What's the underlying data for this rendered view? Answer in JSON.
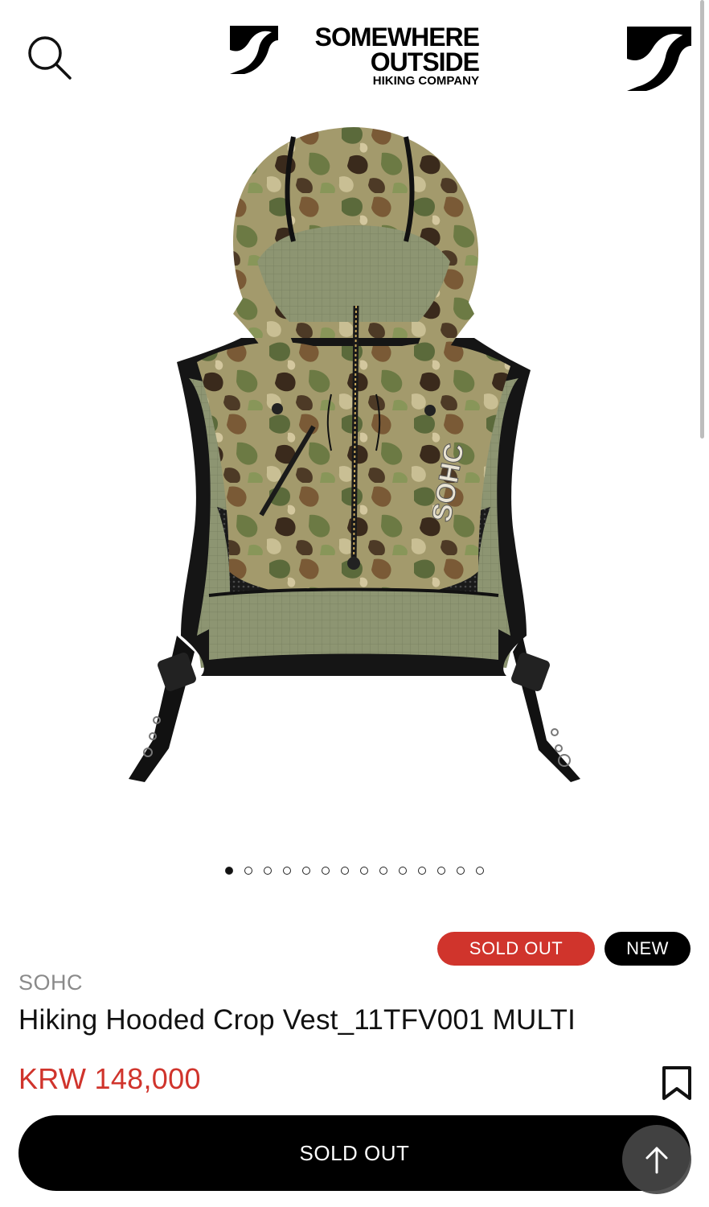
{
  "header": {
    "brand_line1": "SOMEWHERE",
    "brand_line2": "OUTSIDE",
    "brand_line3": "HIKING COMPANY",
    "search_icon": "search-icon",
    "account_icon": "brand-logo-icon"
  },
  "gallery": {
    "image_alt": "Hiking Hooded Crop Vest camo product photo",
    "total_slides": 14,
    "active_slide": 1,
    "mark_text": "SOHC"
  },
  "badges": {
    "sold_out": "SOLD OUT",
    "new": "NEW"
  },
  "product": {
    "brand": "SOHC",
    "title": "Hiking Hooded Crop Vest_11TFV001 MULTI",
    "price": "KRW 148,000",
    "bookmark_icon": "bookmark-icon"
  },
  "actions": {
    "sold_out_button": "SOLD OUT",
    "scroll_top_icon": "arrow-up-icon"
  },
  "colors": {
    "accent_red": "#d0342c",
    "black": "#000000",
    "gray_text": "#8a8a8a"
  }
}
